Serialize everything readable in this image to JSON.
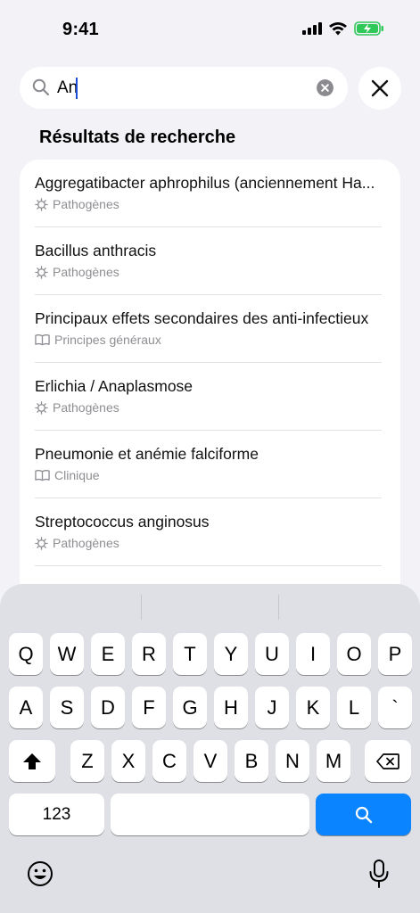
{
  "status": {
    "time": "9:41"
  },
  "search": {
    "value": "An",
    "placeholder": ""
  },
  "section_title": "Résultats de recherche",
  "results": [
    {
      "title": "Aggregatibacter aphrophilus (anciennement Ha...",
      "category": "Pathogènes",
      "icon": "bacteria-icon"
    },
    {
      "title": "Bacillus anthracis",
      "category": "Pathogènes",
      "icon": "bacteria-icon"
    },
    {
      "title": "Principaux effets secondaires des anti-infectieux",
      "category": "Principes généraux",
      "icon": "book-icon"
    },
    {
      "title": "Erlichia / Anaplasmose",
      "category": "Pathogènes",
      "icon": "bacteria-icon"
    },
    {
      "title": "Pneumonie et anémie falciforme",
      "category": "Clinique",
      "icon": "book-icon"
    },
    {
      "title": "Streptococcus anginosus",
      "category": "Pathogènes",
      "icon": "bacteria-icon"
    }
  ],
  "keyboard": {
    "row1": [
      "Q",
      "W",
      "E",
      "R",
      "T",
      "Y",
      "U",
      "I",
      "O",
      "P"
    ],
    "row2": [
      "A",
      "S",
      "D",
      "F",
      "G",
      "H",
      "J",
      "K",
      "L",
      "`"
    ],
    "row3": [
      "Z",
      "X",
      "C",
      "V",
      "B",
      "N",
      "M"
    ],
    "numbers_label": "123"
  },
  "colors": {
    "accent": "#0a84ff",
    "caret": "#1d4ed8"
  }
}
